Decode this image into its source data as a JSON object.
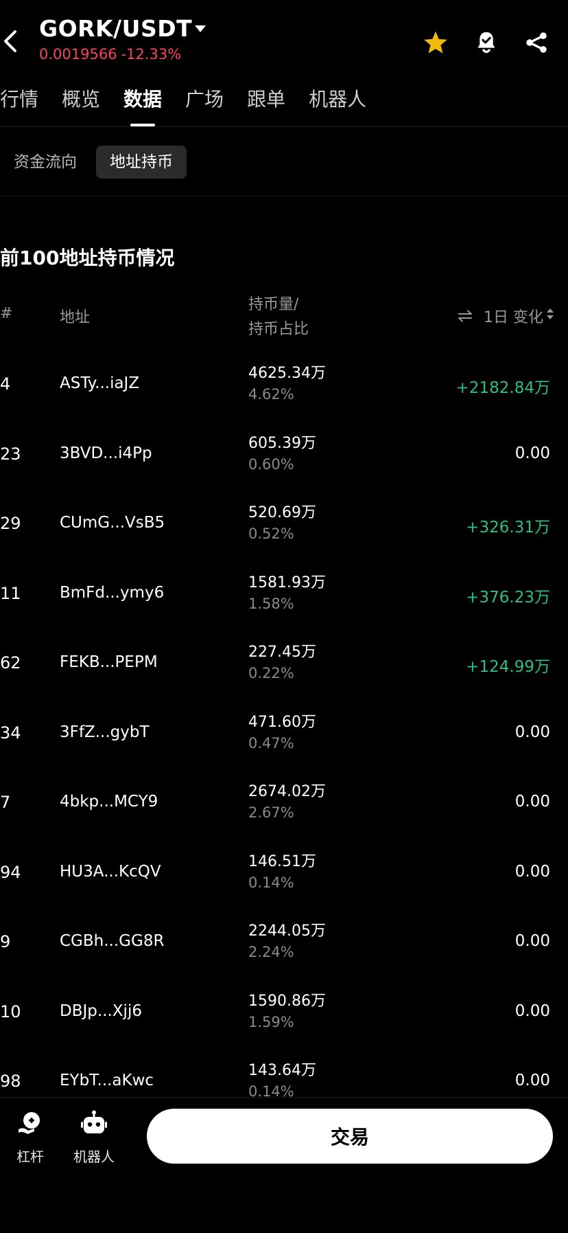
{
  "header": {
    "pair": "GORK/USDT",
    "price": "0.0019566",
    "change": "-12.33%",
    "icons": [
      "back-icon",
      "star-icon",
      "bell-check-icon",
      "share-icon"
    ],
    "colors": {
      "star": "#f0b90b",
      "down": "#f6465d",
      "up": "#2ebd85"
    }
  },
  "tabs": [
    "行情",
    "概览",
    "数据",
    "广场",
    "跟单",
    "机器人"
  ],
  "active_tab": "数据",
  "subtabs": [
    "资金流向",
    "地址持币"
  ],
  "active_subtab": "地址持币",
  "section": {
    "title": "前100地址持币情况",
    "columns": {
      "rank": "#",
      "address": "地址",
      "amount_line1": "持币量/",
      "amount_line2": "持币占比",
      "change": "1日 变化"
    }
  },
  "rows": [
    {
      "rank": "4",
      "address": "ASTy...iaJZ",
      "amount": "4625.34万",
      "pct": "4.62%",
      "change": "+2182.84万",
      "trend": "up"
    },
    {
      "rank": "23",
      "address": "3BVD...i4Pp",
      "amount": "605.39万",
      "pct": "0.60%",
      "change": "0.00",
      "trend": "flat"
    },
    {
      "rank": "29",
      "address": "CUmG...VsB5",
      "amount": "520.69万",
      "pct": "0.52%",
      "change": "+326.31万",
      "trend": "up"
    },
    {
      "rank": "11",
      "address": "BmFd...ymy6",
      "amount": "1581.93万",
      "pct": "1.58%",
      "change": "+376.23万",
      "trend": "up"
    },
    {
      "rank": "62",
      "address": "FEKB...PEPM",
      "amount": "227.45万",
      "pct": "0.22%",
      "change": "+124.99万",
      "trend": "up"
    },
    {
      "rank": "34",
      "address": "3FfZ...gybT",
      "amount": "471.60万",
      "pct": "0.47%",
      "change": "0.00",
      "trend": "flat"
    },
    {
      "rank": "7",
      "address": "4bkp...MCY9",
      "amount": "2674.02万",
      "pct": "2.67%",
      "change": "0.00",
      "trend": "flat"
    },
    {
      "rank": "94",
      "address": "HU3A...KcQV",
      "amount": "146.51万",
      "pct": "0.14%",
      "change": "0.00",
      "trend": "flat"
    },
    {
      "rank": "9",
      "address": "CGBh...GG8R",
      "amount": "2244.05万",
      "pct": "2.24%",
      "change": "0.00",
      "trend": "flat"
    },
    {
      "rank": "10",
      "address": "DBJp...Xjj6",
      "amount": "1590.86万",
      "pct": "1.59%",
      "change": "0.00",
      "trend": "flat"
    },
    {
      "rank": "98",
      "address": "EYbT...aKwc",
      "amount": "143.64万",
      "pct": "0.14%",
      "change": "0.00",
      "trend": "flat"
    }
  ],
  "bottom": {
    "leverage_label": "杠杆",
    "bot_label": "机器人",
    "trade_label": "交易"
  }
}
